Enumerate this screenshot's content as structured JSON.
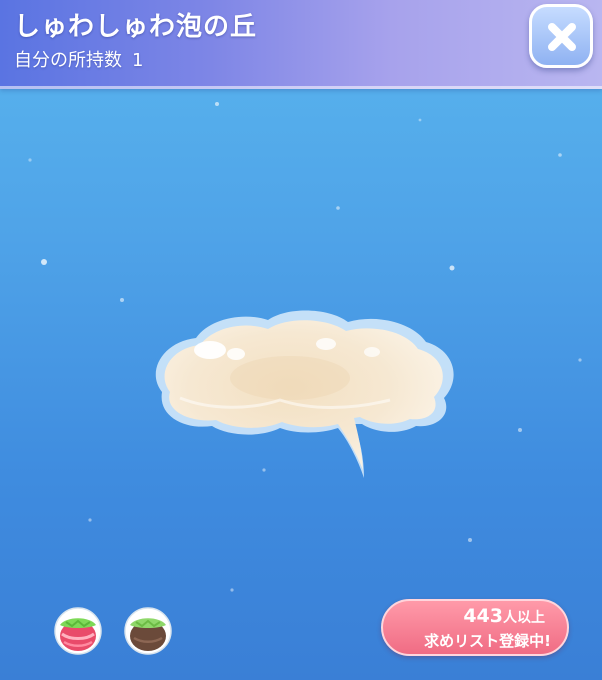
{
  "header": {
    "title": "しゅわしゅわ泡の丘",
    "owned_label": "自分の所持数",
    "owned_count": "1"
  },
  "close_button": {
    "icon": "close-icon"
  },
  "item": {
    "name": "cloud-item-image"
  },
  "bottom_icons": [
    {
      "icon": "strawberry-fruit-icon"
    },
    {
      "icon": "chocolate-fruit-icon"
    }
  ],
  "request_badge": {
    "count": "443",
    "count_suffix": "人以上",
    "message": "求めリスト登録中!"
  },
  "colors": {
    "background_top": "#5ab6ee",
    "background_bottom": "#3a7fd6",
    "header_left": "#5a74e2",
    "header_right": "#b9b6f0",
    "badge": "#f06c84"
  }
}
